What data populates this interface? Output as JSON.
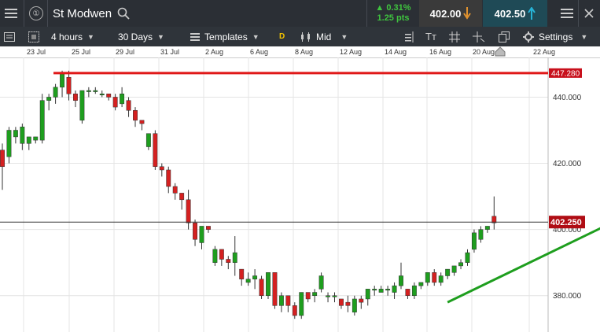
{
  "header": {
    "instrument": "St Modwen",
    "info_icon": "①",
    "change_pct": "0.31%",
    "change_pts": "1.25 pts",
    "sell_price": "402.00",
    "buy_price": "402.50"
  },
  "toolbar": {
    "interval": "4 hours",
    "range": "30 Days",
    "templates": "Templates",
    "d_badge": "D",
    "price_type": "Mid",
    "tt_label": "Tт",
    "settings": "Settings"
  },
  "dates": [
    "23 Jul",
    "25 Jul",
    "29 Jul",
    "31 Jul",
    "2 Aug",
    "6 Aug",
    "8 Aug",
    "12 Aug",
    "14 Aug",
    "16 Aug",
    "20 Aug",
    "22 Aug"
  ],
  "chart_data": {
    "type": "candlestick",
    "y_axis_ticks": [
      "440.000",
      "420.000",
      "400.000",
      "380.000"
    ],
    "ylim": [
      369,
      452
    ],
    "resistance_label": "447.280",
    "resistance_value": 447.28,
    "current_label": "402.250",
    "current_value": 402.25,
    "trendline": {
      "from": [
        67,
        378.0
      ],
      "to": [
        103,
        413.0
      ]
    },
    "candles": [
      [
        0,
        424,
        419,
        426,
        412
      ],
      [
        1,
        422,
        430,
        431,
        420
      ],
      [
        2,
        428,
        430,
        431,
        426
      ],
      [
        3,
        426,
        431,
        432,
        424
      ],
      [
        4,
        426,
        428,
        428,
        424
      ],
      [
        5,
        427,
        428,
        428,
        426
      ],
      [
        6,
        427,
        439,
        441,
        426
      ],
      [
        7,
        439,
        440,
        441,
        436
      ],
      [
        8,
        440,
        443,
        444,
        438
      ],
      [
        9,
        443,
        447,
        448,
        440
      ],
      [
        10,
        446,
        441,
        448,
        439
      ],
      [
        11,
        441,
        439,
        442,
        437
      ],
      [
        12,
        433,
        442,
        442,
        432
      ],
      [
        13,
        442,
        442,
        443,
        440
      ],
      [
        14,
        442,
        442,
        443,
        441
      ],
      [
        15,
        441,
        441,
        442,
        440
      ],
      [
        16,
        441,
        440,
        441,
        439
      ],
      [
        17,
        440,
        437,
        441,
        436
      ],
      [
        18,
        438,
        441,
        443,
        437
      ],
      [
        19,
        439,
        436,
        440,
        434
      ],
      [
        20,
        436,
        433,
        437,
        431
      ],
      [
        21,
        433,
        432,
        433,
        430
      ],
      [
        22,
        425,
        429,
        429,
        424
      ],
      [
        23,
        429,
        419,
        430,
        418
      ],
      [
        24,
        419,
        418,
        420,
        416
      ],
      [
        25,
        418,
        413,
        419,
        411
      ],
      [
        26,
        413,
        411,
        414,
        409
      ],
      [
        27,
        411,
        409,
        411,
        406
      ],
      [
        28,
        409,
        402,
        412,
        400
      ],
      [
        29,
        402,
        397,
        403,
        395
      ],
      [
        30,
        396,
        401,
        401,
        394
      ],
      [
        31,
        401,
        400,
        401,
        399
      ],
      [
        32,
        390,
        394,
        395,
        389
      ],
      [
        33,
        394,
        391,
        394,
        389
      ],
      [
        34,
        391,
        390,
        392,
        388
      ],
      [
        35,
        390,
        393,
        398,
        386
      ],
      [
        36,
        388,
        385,
        388,
        383
      ],
      [
        37,
        384,
        385,
        387,
        383
      ],
      [
        38,
        385,
        386,
        388,
        382
      ],
      [
        39,
        385,
        380,
        386,
        379
      ],
      [
        40,
        380,
        387,
        387,
        379
      ],
      [
        41,
        387,
        377,
        387,
        376
      ],
      [
        42,
        377,
        380,
        381,
        375
      ],
      [
        43,
        380,
        377,
        380,
        375
      ],
      [
        44,
        377,
        374,
        378,
        373
      ],
      [
        45,
        374,
        381,
        381,
        373
      ],
      [
        46,
        381,
        379,
        381,
        378
      ],
      [
        47,
        380,
        381,
        382,
        378
      ],
      [
        48,
        382,
        386,
        387,
        381
      ],
      [
        49,
        380,
        380,
        381,
        378
      ],
      [
        50,
        380,
        380,
        381,
        378
      ],
      [
        51,
        379,
        377,
        379,
        376
      ],
      [
        52,
        378,
        377,
        380,
        375
      ],
      [
        53,
        375,
        379,
        380,
        374
      ],
      [
        54,
        379,
        378,
        380,
        376
      ],
      [
        55,
        379,
        382,
        382,
        377
      ],
      [
        56,
        382,
        382,
        383,
        380
      ],
      [
        57,
        381,
        382,
        383,
        381
      ],
      [
        58,
        382,
        382,
        383,
        380
      ],
      [
        59,
        381,
        383,
        384,
        379
      ],
      [
        60,
        383,
        386,
        390,
        382
      ],
      [
        61,
        382,
        380,
        382,
        379
      ],
      [
        62,
        380,
        383,
        384,
        379
      ],
      [
        63,
        383,
        384,
        384,
        382
      ],
      [
        64,
        384,
        387,
        387,
        383
      ],
      [
        65,
        387,
        384,
        388,
        383
      ],
      [
        66,
        384,
        386,
        387,
        383
      ],
      [
        67,
        386,
        388,
        388,
        385
      ],
      [
        68,
        387,
        389,
        389,
        386
      ],
      [
        69,
        389,
        390,
        391,
        388
      ],
      [
        70,
        390,
        393,
        394,
        389
      ],
      [
        71,
        394,
        399,
        400,
        393
      ],
      [
        72,
        397,
        400,
        401,
        396
      ],
      [
        73,
        400,
        401,
        401,
        399
      ],
      [
        74,
        404,
        402,
        410,
        400
      ]
    ]
  }
}
